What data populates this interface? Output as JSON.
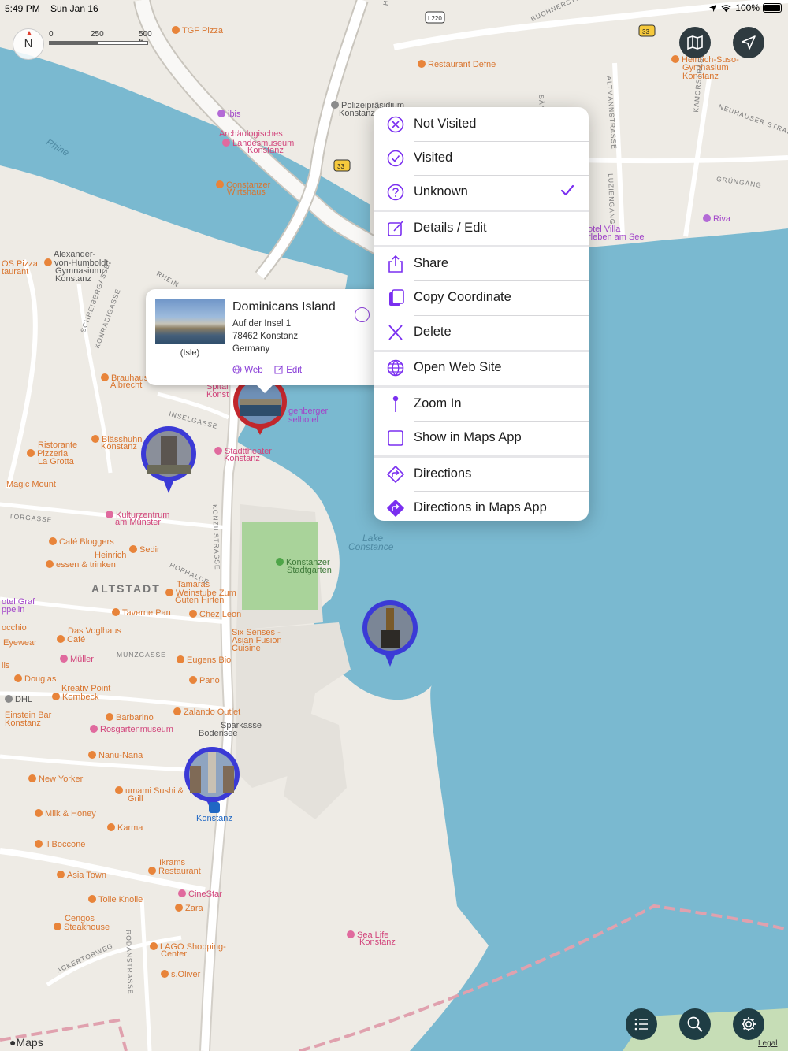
{
  "status_bar": {
    "time": "5:49 PM",
    "date": "Sun Jan 16",
    "battery": "100%"
  },
  "compass": {
    "label": "N"
  },
  "scale": {
    "ticks": [
      "0",
      "250",
      "500 ft"
    ]
  },
  "highway_shields": [
    "L220",
    "33",
    "33"
  ],
  "map_labels": [
    {
      "text": "TGF Pizza",
      "cls": "",
      "poi": "#e8843a"
    },
    {
      "text": "Restaurant Defne",
      "cls": "",
      "poi": "#e8843a"
    },
    {
      "text": "Heinrich-Suso-",
      "cls": "",
      "poi": "#e8843a"
    },
    {
      "text": "Gymnasium",
      "cls": ""
    },
    {
      "text": "Konstanz",
      "cls": ""
    },
    {
      "text": "ibis",
      "cls": "purple",
      "poi": "#b36ad6"
    },
    {
      "text": "Polizeipräsidium",
      "cls": "gray",
      "poi": "#8b8b8b"
    },
    {
      "text": "Konstanz",
      "cls": "gray"
    },
    {
      "text": "Archäologisches",
      "cls": "pink"
    },
    {
      "text": "Landesmuseum",
      "cls": "pink",
      "poi": "#e06a9e"
    },
    {
      "text": "Konstanz",
      "cls": "pink"
    },
    {
      "text": "Constanzer",
      "cls": "",
      "poi": "#e8843a"
    },
    {
      "text": "Wirtshaus",
      "cls": ""
    },
    {
      "text": "Riva",
      "cls": "purple",
      "poi": "#b36ad6"
    },
    {
      "text": "otel Villa",
      "cls": "purple"
    },
    {
      "text": "rleben am See",
      "cls": "purple"
    },
    {
      "text": "OS Pizza",
      "cls": ""
    },
    {
      "text": "taurant",
      "cls": ""
    },
    {
      "text": "Alexander-",
      "cls": "gray"
    },
    {
      "text": "von-Humboldt-",
      "cls": "gray",
      "poi": "#e8843a"
    },
    {
      "text": "Gymnasium,",
      "cls": "gray"
    },
    {
      "text": "Konstanz",
      "cls": "gray"
    },
    {
      "text": "Brauhaus",
      "cls": "",
      "poi": "#e8843a"
    },
    {
      "text": "Albrecht",
      "cls": ""
    },
    {
      "text": "Spital",
      "cls": "pink"
    },
    {
      "text": "Konst",
      "cls": "pink"
    },
    {
      "text": "genberger",
      "cls": "purple"
    },
    {
      "text": "selhotel",
      "cls": "purple"
    },
    {
      "text": "Blässhuhn",
      "cls": "",
      "poi": "#e8843a"
    },
    {
      "text": "Konstanz",
      "cls": ""
    },
    {
      "text": "Ristorante",
      "cls": ""
    },
    {
      "text": "Pizzeria",
      "cls": "",
      "poi": "#e8843a"
    },
    {
      "text": "La Grotta",
      "cls": ""
    },
    {
      "text": "Stadttheater",
      "cls": "pink",
      "poi": "#e06a9e"
    },
    {
      "text": "Konstanz",
      "cls": "pink"
    },
    {
      "text": "Magic Mount",
      "cls": ""
    },
    {
      "text": "Kulturzentrum",
      "cls": "pink",
      "poi": "#e06a9e"
    },
    {
      "text": "am Münster",
      "cls": "pink"
    },
    {
      "text": "Café Bloggers",
      "cls": "",
      "poi": "#e8843a"
    },
    {
      "text": "Sedir",
      "cls": "",
      "poi": "#e8843a"
    },
    {
      "text": "Heinrich",
      "cls": ""
    },
    {
      "text": "essen & trinken",
      "cls": "",
      "poi": "#e8843a"
    },
    {
      "text": "Konstanzer",
      "cls": "green",
      "poi": "#4ea548"
    },
    {
      "text": "Stadtgarten",
      "cls": "green"
    },
    {
      "text": "Tamaras",
      "cls": ""
    },
    {
      "text": "Weinstube Zum",
      "cls": "",
      "poi": "#e8843a"
    },
    {
      "text": "Guten Hirten",
      "cls": ""
    },
    {
      "text": "otel Graf",
      "cls": "purple"
    },
    {
      "text": "ppelin",
      "cls": "purple"
    },
    {
      "text": "Taverne Pan",
      "cls": "",
      "poi": "#e8843a"
    },
    {
      "text": "Chez Leon",
      "cls": "",
      "poi": "#e8843a"
    },
    {
      "text": "occhio",
      "cls": ""
    },
    {
      "text": "Das Voglhaus",
      "cls": ""
    },
    {
      "text": "Café",
      "cls": "",
      "poi": "#e8843a"
    },
    {
      "text": "Six Senses -",
      "cls": ""
    },
    {
      "text": "Asian Fusion",
      "cls": ""
    },
    {
      "text": "Cuisine",
      "cls": ""
    },
    {
      "text": "Eyewear",
      "cls": ""
    },
    {
      "text": "Müller",
      "cls": "pink",
      "poi": "#e06a9e"
    },
    {
      "text": "Eugens Bio",
      "cls": "",
      "poi": "#e8843a"
    },
    {
      "text": "lis",
      "cls": ""
    },
    {
      "text": "Douglas",
      "cls": "",
      "poi": "#e8843a"
    },
    {
      "text": "Pano",
      "cls": "",
      "poi": "#e8843a"
    },
    {
      "text": "Kreativ Point",
      "cls": ""
    },
    {
      "text": "Kornbeck",
      "cls": "",
      "poi": "#e8843a"
    },
    {
      "text": "DHL",
      "cls": "gray",
      "poi": "#8b8b8b"
    },
    {
      "text": "Zalando Outlet",
      "cls": "",
      "poi": "#e8843a"
    },
    {
      "text": "Einstein Bar",
      "cls": ""
    },
    {
      "text": "Konstanz",
      "cls": ""
    },
    {
      "text": "Barbarino",
      "cls": "",
      "poi": "#e8843a"
    },
    {
      "text": "Sparkasse",
      "cls": "gray"
    },
    {
      "text": "Bodensee",
      "cls": "gray"
    },
    {
      "text": "Rosgartenmuseum",
      "cls": "pink",
      "poi": "#e06a9e"
    },
    {
      "text": "Nanu-Nana",
      "cls": "",
      "poi": "#e8843a"
    },
    {
      "text": "New Yorker",
      "cls": "",
      "poi": "#e8843a"
    },
    {
      "text": "umami Sushi &",
      "cls": "",
      "poi": "#e8843a"
    },
    {
      "text": "Grill",
      "cls": ""
    },
    {
      "text": "Milk & Honey",
      "cls": "",
      "poi": "#e8843a"
    },
    {
      "text": "Karma",
      "cls": "",
      "poi": "#e8843a"
    },
    {
      "text": "Konstanz",
      "cls": "blue"
    },
    {
      "text": "Il Boccone",
      "cls": "",
      "poi": "#e8843a"
    },
    {
      "text": "Ikrams",
      "cls": ""
    },
    {
      "text": "Restaurant",
      "cls": "",
      "poi": "#e8843a"
    },
    {
      "text": "Asia Town",
      "cls": "",
      "poi": "#e8843a"
    },
    {
      "text": "CineStar",
      "cls": "pink",
      "poi": "#e06a9e"
    },
    {
      "text": "Tolle Knolle",
      "cls": "",
      "poi": "#e8843a"
    },
    {
      "text": "Zara",
      "cls": "",
      "poi": "#e8843a"
    },
    {
      "text": "Cengos",
      "cls": ""
    },
    {
      "text": "Steakhouse",
      "cls": "",
      "poi": "#e8843a"
    },
    {
      "text": "LAGO Shopping-",
      "cls": "",
      "poi": "#e8843a"
    },
    {
      "text": "Center",
      "cls": ""
    },
    {
      "text": "Sea Life",
      "cls": "pink",
      "poi": "#e06a9e"
    },
    {
      "text": "Konstanz",
      "cls": "pink"
    },
    {
      "text": "s.Oliver",
      "cls": "",
      "poi": "#e8843a"
    },
    {
      "text": "Lake",
      "cls": "water"
    },
    {
      "text": "Constance",
      "cls": "water"
    },
    {
      "text": "ALTSTADT",
      "cls": "district"
    },
    {
      "text": "Rhine",
      "cls": "water"
    },
    {
      "text": "RHEIN",
      "cls": "street"
    },
    {
      "text": "SCHREIBERGASSE",
      "cls": "street"
    },
    {
      "text": "KONRADIGASSE",
      "cls": "street"
    },
    {
      "text": "INSELGASSE",
      "cls": "street"
    },
    {
      "text": "TORGASSE",
      "cls": "street"
    },
    {
      "text": "HOFHALDE",
      "cls": "street"
    },
    {
      "text": "KONZILSTRASSE",
      "cls": "street"
    },
    {
      "text": "MÜNZGASSE",
      "cls": "street"
    },
    {
      "text": "ACKERTORWEG",
      "cls": "street"
    },
    {
      "text": "RODANSTRASSE",
      "cls": "street"
    },
    {
      "text": "BUCHNERSTRASSE",
      "cls": "street"
    },
    {
      "text": "ALTMANNSTRASSE",
      "cls": "street"
    },
    {
      "text": "KAMORSTRASSE",
      "cls": "street"
    },
    {
      "text": "NEUHAUSER STRASSE",
      "cls": "street"
    },
    {
      "text": "GRÜNGANG",
      "cls": "street"
    },
    {
      "text": "LUZIENGANG",
      "cls": "street"
    },
    {
      "text": "HEGAUS",
      "cls": "street"
    },
    {
      "text": "SÄN",
      "cls": "street"
    }
  ],
  "callout": {
    "title": "Dominicans Island",
    "caption": "(Isle)",
    "address_line1": "Auf der Insel 1",
    "address_line2": "78462 Konstanz",
    "address_line3": "Germany",
    "web_label": "Web",
    "edit_label": "Edit"
  },
  "menu": {
    "items": [
      {
        "label": "Not Visited",
        "icon": "x-circle-icon"
      },
      {
        "label": "Visited",
        "icon": "check-circle-icon"
      },
      {
        "label": "Unknown",
        "icon": "question-circle-icon",
        "checked": true
      },
      {
        "label": "Details / Edit",
        "icon": "edit-icon"
      },
      {
        "label": "Share",
        "icon": "share-icon"
      },
      {
        "label": "Copy Coordinate",
        "icon": "copy-icon"
      },
      {
        "label": "Delete",
        "icon": "x-icon"
      },
      {
        "label": "Open Web Site",
        "icon": "globe-icon"
      },
      {
        "label": "Zoom In",
        "icon": "pin-icon"
      },
      {
        "label": "Show in Maps App",
        "icon": "square-icon"
      },
      {
        "label": "Directions",
        "icon": "directions-icon"
      },
      {
        "label": "Directions in Maps App",
        "icon": "directions-fill-icon"
      }
    ]
  },
  "attribution": {
    "maps": "Maps",
    "legal": "Legal"
  },
  "colors": {
    "accent": "#7a2ff0",
    "water": "#7ab9d0",
    "land": "#eeebe5",
    "park": "#a9d39a"
  }
}
